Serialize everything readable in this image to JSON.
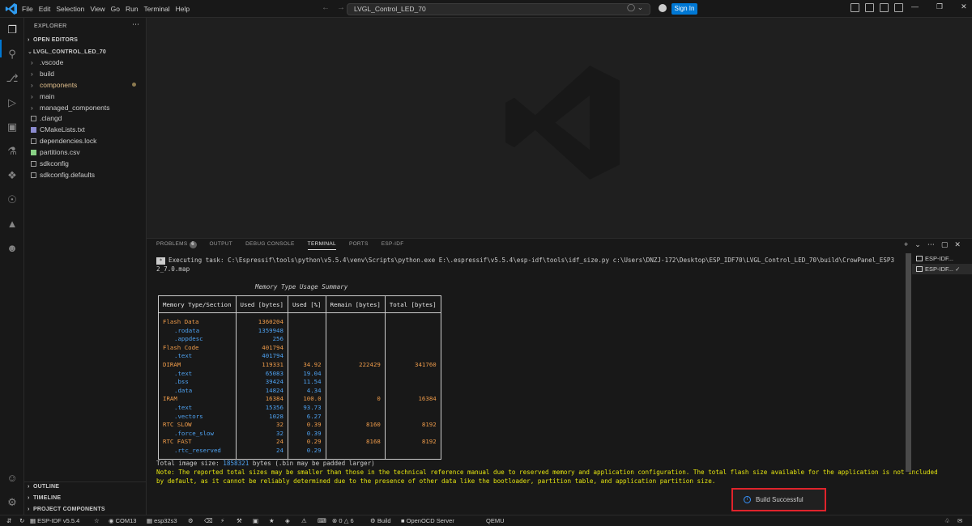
{
  "titlebar": {
    "menu": [
      "File",
      "Edit",
      "Selection",
      "View",
      "Go",
      "Run",
      "Terminal",
      "Help"
    ],
    "search_text": "LVGL_Control_LED_70",
    "signin_label": "Sign In"
  },
  "sidebar": {
    "title": "EXPLORER",
    "open_editors": "OPEN EDITORS",
    "project": "LVGL_CONTROL_LED_70",
    "items": [
      {
        "label": ".vscode",
        "kind": "folder"
      },
      {
        "label": "build",
        "kind": "folder"
      },
      {
        "label": "components",
        "kind": "folder-modified"
      },
      {
        "label": "main",
        "kind": "folder"
      },
      {
        "label": "managed_components",
        "kind": "folder"
      },
      {
        "label": ".clangd",
        "kind": "file"
      },
      {
        "label": "CMakeLists.txt",
        "kind": "file-cmake"
      },
      {
        "label": "dependencies.lock",
        "kind": "file"
      },
      {
        "label": "partitions.csv",
        "kind": "file-csv"
      },
      {
        "label": "sdkconfig",
        "kind": "file"
      },
      {
        "label": "sdkconfig.defaults",
        "kind": "file"
      }
    ],
    "outline": "OUTLINE",
    "timeline": "TIMELINE",
    "project_components": "PROJECT COMPONENTS"
  },
  "panel": {
    "tabs": [
      "PROBLEMS",
      "OUTPUT",
      "DEBUG CONSOLE",
      "TERMINAL",
      "PORTS",
      "ESP-IDF"
    ],
    "problems_count": "6",
    "terminals": [
      "ESP-IDF...",
      "ESP-IDF..."
    ]
  },
  "terminal": {
    "task_line_1": "Executing task: C:\\Espressif\\tools\\python\\v5.5.4\\venv\\Scripts\\python.exe E:\\.espressif\\v5.5.4\\esp-idf\\tools\\idf_size.py c:\\Users\\DNZJ-172\\Desktop\\ESP_IDF70\\LVGL_Control_LED_70\\build\\CrowPanel_ESP3",
    "task_line_2": "2_7.0.map",
    "summary_title": "Memory Type Usage Summary",
    "headers": [
      "Memory Type/Section",
      "Used [bytes]",
      "Used [%]",
      "Remain [bytes]",
      "Total [bytes]"
    ],
    "rows": [
      {
        "kind": "main",
        "name": "Flash Data",
        "used": "1360204",
        "pct": "",
        "remain": "",
        "total": ""
      },
      {
        "kind": "sub",
        "name": ".rodata",
        "used": "1359948",
        "pct": "",
        "remain": "",
        "total": ""
      },
      {
        "kind": "sub",
        "name": ".appdesc",
        "used": "256",
        "pct": "",
        "remain": "",
        "total": ""
      },
      {
        "kind": "main",
        "name": "Flash Code",
        "used": "401794",
        "pct": "",
        "remain": "",
        "total": ""
      },
      {
        "kind": "sub",
        "name": ".text",
        "used": "401794",
        "pct": "",
        "remain": "",
        "total": ""
      },
      {
        "kind": "main",
        "name": "DIRAM",
        "used": "119331",
        "pct": "34.92",
        "remain": "222429",
        "total": "341760"
      },
      {
        "kind": "sub",
        "name": ".text",
        "used": "65083",
        "pct": "19.04",
        "remain": "",
        "total": ""
      },
      {
        "kind": "sub",
        "name": ".bss",
        "used": "39424",
        "pct": "11.54",
        "remain": "",
        "total": ""
      },
      {
        "kind": "sub",
        "name": ".data",
        "used": "14824",
        "pct": "4.34",
        "remain": "",
        "total": ""
      },
      {
        "kind": "main",
        "name": "IRAM",
        "used": "16384",
        "pct": "100.0",
        "remain": "0",
        "total": "16384"
      },
      {
        "kind": "sub",
        "name": ".text",
        "used": "15356",
        "pct": "93.73",
        "remain": "",
        "total": ""
      },
      {
        "kind": "sub",
        "name": ".vectors",
        "used": "1028",
        "pct": "6.27",
        "remain": "",
        "total": ""
      },
      {
        "kind": "main",
        "name": "RTC SLOW",
        "used": "32",
        "pct": "0.39",
        "remain": "8160",
        "total": "8192"
      },
      {
        "kind": "sub",
        "name": ".force_slow",
        "used": "32",
        "pct": "0.39",
        "remain": "",
        "total": ""
      },
      {
        "kind": "main",
        "name": "RTC FAST",
        "used": "24",
        "pct": "0.29",
        "remain": "8168",
        "total": "8192"
      },
      {
        "kind": "sub",
        "name": ".rtc_reserved",
        "used": "24",
        "pct": "0.29",
        "remain": "",
        "total": ""
      }
    ],
    "total_prefix": "Total image size: ",
    "total_value": "1858321",
    "total_suffix": " bytes (.bin may be padded larger)",
    "note_line_1": "Note: The reported total sizes may be smaller than those in the technical reference manual due to reserved memory and application configuration. The total flash size available for the application is not included",
    "note_line_2": " by default, as it cannot be reliably determined due to the presence of other data like the bootloader, partition table, and application partition size."
  },
  "notification": {
    "text": "Build Successful"
  },
  "statusbar": {
    "idf_version": "ESP-IDF v5.5.4",
    "port": "COM13",
    "target": "esp32s3",
    "errors": "0",
    "warnings": "6",
    "build": "Build",
    "openocd": "OpenOCD Server",
    "qemu": "QEMU"
  },
  "colors": {
    "accent": "#0078d4",
    "section_main": "#ee9b4a",
    "section_sub": "#4ea1f0",
    "note": "#e5e510",
    "highlight_border": "#e0232b"
  }
}
